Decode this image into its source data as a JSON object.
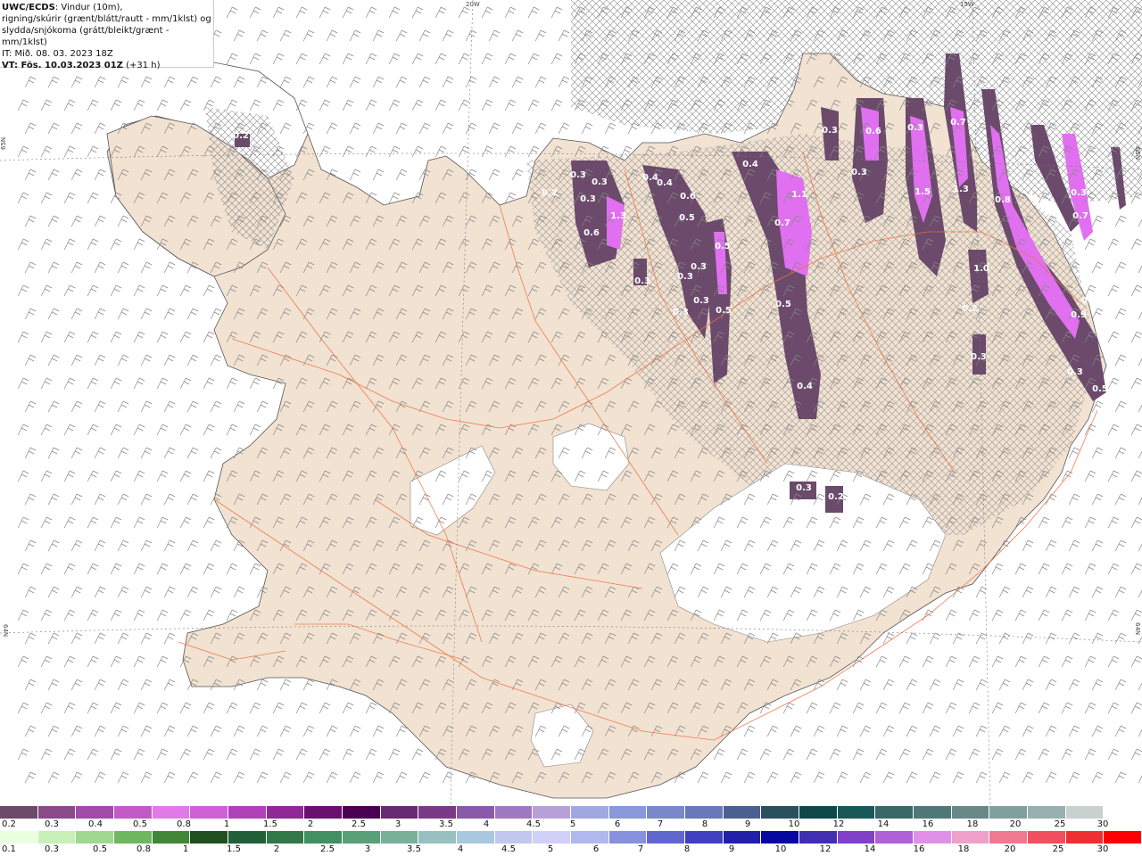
{
  "title": {
    "source": "UWC/ECDS",
    "description_line1": ": Vindur (10m),",
    "description_line2": "rigning/skúrir (grænt/blátt/rautt - mm/1klst) og",
    "description_line3": "slydda/snjókoma (grátt/bleikt/grænt - mm/1klst)",
    "issued": "IT: Mið. 08. 03. 2023 18Z",
    "valid_label": "VT: Fös. 10.03.2023 01Z",
    "valid_offset": " (+31 h)"
  },
  "coords": {
    "top_left": "20W",
    "top_right": "15W",
    "left_top": "65N",
    "left_bottom": "64N",
    "right_top": "65N",
    "right_bottom": "64N"
  },
  "map_labels": [
    {
      "text": "0.2"
    },
    {
      "text": "0.3"
    },
    {
      "text": "0.3"
    },
    {
      "text": "0.3"
    },
    {
      "text": "0.2"
    },
    {
      "text": "1.3"
    },
    {
      "text": "0.6"
    },
    {
      "text": "0.3"
    },
    {
      "text": "0.4"
    },
    {
      "text": "0.4"
    },
    {
      "text": "0.6"
    },
    {
      "text": "0.5"
    },
    {
      "text": "0.3"
    },
    {
      "text": "0.3"
    },
    {
      "text": "0.5"
    },
    {
      "text": "0.3"
    },
    {
      "text": "0.3"
    },
    {
      "text": "0.5"
    },
    {
      "text": "0.4"
    },
    {
      "text": "1.1"
    },
    {
      "text": "0.7"
    },
    {
      "text": "0.5"
    },
    {
      "text": "0.4"
    },
    {
      "text": "0.3"
    },
    {
      "text": "0.6"
    },
    {
      "text": "0.3"
    },
    {
      "text": "0.3"
    },
    {
      "text": "0.7"
    },
    {
      "text": "1.5"
    },
    {
      "text": "1.3"
    },
    {
      "text": "0.8"
    },
    {
      "text": "0.7"
    },
    {
      "text": "1.0"
    },
    {
      "text": "0.2"
    },
    {
      "text": "0.3"
    },
    {
      "text": "0.9"
    },
    {
      "text": "0.3"
    },
    {
      "text": "0.3"
    },
    {
      "text": "0.5"
    },
    {
      "text": "0.3"
    },
    {
      "text": "0.2"
    },
    {
      "text": "0.3"
    }
  ],
  "legend_snow": {
    "colors": [
      "#6b4a6b",
      "#8a4a8a",
      "#a24aa8",
      "#c25ac8",
      "#e07ae8",
      "#d060d8",
      "#b040b8",
      "#902898",
      "#6a1070",
      "#4a0050",
      "#682a72",
      "#7a3a88",
      "#8a5aa8",
      "#a07ac0",
      "#b8a0d8",
      "#a0a8e0",
      "#8898d8",
      "#7888c8",
      "#6878b8",
      "#4a6090",
      "#2a5060",
      "#104848",
      "#1a5858",
      "#3a6868",
      "#507878",
      "#688888",
      "#80a0a0",
      "#98b0b0",
      "#c8d0d0",
      "#ffffff"
    ],
    "labels": [
      "0.2",
      "0.3",
      "0.4",
      "0.5",
      "0.8",
      "1",
      "1.5",
      "2",
      "2.5",
      "3",
      "3.5",
      "4",
      "4.5",
      "5",
      "6",
      "7",
      "8",
      "9",
      "10",
      "12",
      "14",
      "16",
      "18",
      "20",
      "25",
      "30"
    ]
  },
  "legend_rain": {
    "colors": [
      "#e8ffe0",
      "#c8f0b8",
      "#a0d890",
      "#70b860",
      "#408838",
      "#205020",
      "#206038",
      "#307848",
      "#409060",
      "#58a078",
      "#78b098",
      "#98c0c0",
      "#a8c8e0",
      "#c0c8f0",
      "#d0d0f8",
      "#b0b8f0",
      "#8890e0",
      "#6068d0",
      "#4040c0",
      "#2020a8",
      "#0808a0",
      "#4030b0",
      "#8040c8",
      "#b060d8",
      "#e090e8",
      "#f0a0c8",
      "#f07890",
      "#f05060",
      "#f03030",
      "#ff0000"
    ],
    "labels": [
      "0.1",
      "0.3",
      "0.5",
      "0.8",
      "1",
      "1.5",
      "2",
      "2.5",
      "3",
      "3.5",
      "4",
      "4.5",
      "5",
      "6",
      "7",
      "8",
      "9",
      "10",
      "12",
      "14",
      "16",
      "18",
      "20",
      "25",
      "30"
    ]
  },
  "colors": {
    "land": "#f2e2d2",
    "sea": "#ffffff",
    "glacier": "#ffffff",
    "roads": "#ee7040",
    "barbs": "#888888",
    "snow_light": "#6b4a6b",
    "snow_mid": "#a24aa8",
    "snow_strong": "#e070f0"
  }
}
